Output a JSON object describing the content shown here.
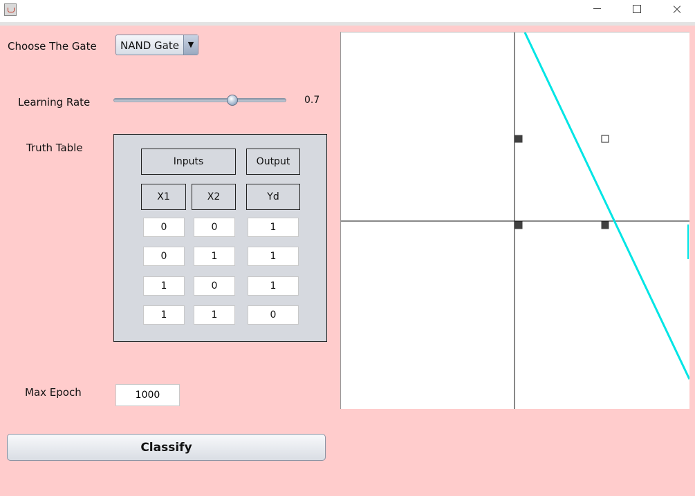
{
  "window": {
    "title": ""
  },
  "controls": {
    "gate_label": "Choose The Gate",
    "gate_selected": "NAND Gate",
    "learning_rate_label": "Learning Rate",
    "learning_rate_value": "0.7",
    "truth_table_label": "Truth Table",
    "max_epoch_label": "Max Epoch",
    "max_epoch_value": "1000",
    "classify_label": "Classify"
  },
  "truth_table": {
    "headers": {
      "inputs": "Inputs",
      "output": "Output",
      "x1": "X1",
      "x2": "X2",
      "yd": "Yd"
    },
    "rows": [
      {
        "x1": "0",
        "x2": "0",
        "yd": "1"
      },
      {
        "x1": "0",
        "x2": "1",
        "yd": "1"
      },
      {
        "x1": "1",
        "x2": "0",
        "yd": "1"
      },
      {
        "x1": "1",
        "x2": "1",
        "yd": "0"
      }
    ]
  },
  "plot": {
    "line_color": "#00e5e5",
    "points": [
      {
        "x1": 0,
        "x2": 0,
        "class": 1
      },
      {
        "x1": 0,
        "x2": 1,
        "class": 1
      },
      {
        "x1": 1,
        "x2": 0,
        "class": 1
      },
      {
        "x1": 1,
        "x2": 1,
        "class": 0
      }
    ]
  }
}
